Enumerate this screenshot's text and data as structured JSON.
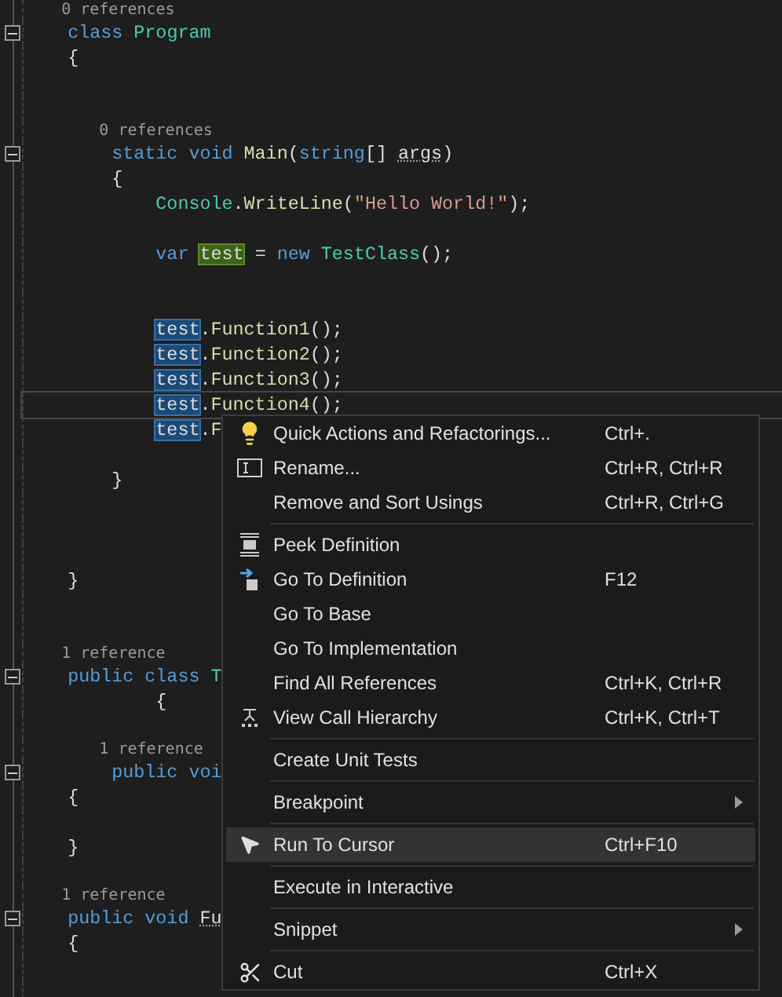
{
  "editor": {
    "lines": [
      {
        "kind": "lens",
        "text": "    0 references"
      },
      {
        "kind": "code",
        "collapsible": true,
        "tokens": [
          {
            "kind": "keyword",
            "text": "    class "
          },
          {
            "kind": "type",
            "text": "Program"
          }
        ]
      },
      {
        "kind": "code",
        "tokens": [
          {
            "kind": "plain",
            "text": "    {"
          }
        ]
      },
      {
        "kind": "blank"
      },
      {
        "kind": "blank"
      },
      {
        "kind": "lens",
        "text": "        0 references"
      },
      {
        "kind": "code",
        "collapsible": true,
        "tokens": [
          {
            "kind": "keyword",
            "text": "        static void "
          },
          {
            "kind": "method",
            "text": "Main"
          },
          {
            "kind": "plain",
            "text": "("
          },
          {
            "kind": "keyword",
            "text": "string"
          },
          {
            "kind": "plain",
            "text": "[] "
          },
          {
            "kind": "unused",
            "text": "args"
          },
          {
            "kind": "plain",
            "text": ")"
          }
        ]
      },
      {
        "kind": "code",
        "tokens": [
          {
            "kind": "plain",
            "text": "        {"
          }
        ]
      },
      {
        "kind": "code",
        "tokens": [
          {
            "kind": "type",
            "text": "            Console"
          },
          {
            "kind": "plain",
            "text": "."
          },
          {
            "kind": "method",
            "text": "WriteLine"
          },
          {
            "kind": "plain",
            "text": "("
          },
          {
            "kind": "string",
            "text": "\"Hello World!\""
          },
          {
            "kind": "plain",
            "text": ");"
          }
        ]
      },
      {
        "kind": "blank"
      },
      {
        "kind": "code",
        "tokens": [
          {
            "kind": "keyword",
            "text": "            var "
          },
          {
            "kind": "write-ref",
            "text": "test"
          },
          {
            "kind": "plain",
            "text": " = "
          },
          {
            "kind": "keyword",
            "text": "new "
          },
          {
            "kind": "type",
            "text": "TestClass"
          },
          {
            "kind": "plain",
            "text": "();"
          }
        ]
      },
      {
        "kind": "blank"
      },
      {
        "kind": "blank"
      },
      {
        "kind": "code",
        "tokens": [
          {
            "kind": "read-ref",
            "text": "            test"
          },
          {
            "kind": "plain",
            "text": "."
          },
          {
            "kind": "method",
            "text": "Function1"
          },
          {
            "kind": "plain",
            "text": "();"
          }
        ]
      },
      {
        "kind": "code",
        "tokens": [
          {
            "kind": "read-ref",
            "text": "            test"
          },
          {
            "kind": "plain",
            "text": "."
          },
          {
            "kind": "method",
            "text": "Function2"
          },
          {
            "kind": "plain",
            "text": "();"
          }
        ]
      },
      {
        "kind": "code",
        "tokens": [
          {
            "kind": "read-ref",
            "text": "            test"
          },
          {
            "kind": "plain",
            "text": "."
          },
          {
            "kind": "method",
            "text": "Function3"
          },
          {
            "kind": "plain",
            "text": "();"
          }
        ]
      },
      {
        "kind": "code",
        "current": true,
        "tokens": [
          {
            "kind": "read-ref",
            "text": "            test"
          },
          {
            "kind": "plain",
            "text": "."
          },
          {
            "kind": "method",
            "text": "Function4"
          },
          {
            "kind": "plain",
            "text": "();"
          }
        ]
      },
      {
        "kind": "code",
        "tokens": [
          {
            "kind": "read-ref",
            "text": "            test"
          },
          {
            "kind": "plain",
            "text": "."
          },
          {
            "kind": "method",
            "text": "F"
          }
        ]
      },
      {
        "kind": "blank"
      },
      {
        "kind": "code",
        "tokens": [
          {
            "kind": "plain",
            "text": "        }"
          }
        ]
      },
      {
        "kind": "blank"
      },
      {
        "kind": "blank"
      },
      {
        "kind": "blank"
      },
      {
        "kind": "code",
        "tokens": [
          {
            "kind": "plain",
            "text": "    }"
          }
        ]
      },
      {
        "kind": "blank"
      },
      {
        "kind": "blank"
      },
      {
        "kind": "lens",
        "text": "    1 reference"
      },
      {
        "kind": "code",
        "collapsible": true,
        "tokens": [
          {
            "kind": "keyword",
            "text": "    public class "
          },
          {
            "kind": "type",
            "text": "T"
          }
        ]
      },
      {
        "kind": "code",
        "tokens": [
          {
            "kind": "plain",
            "text": "            {"
          }
        ]
      },
      {
        "kind": "blank"
      },
      {
        "kind": "lens",
        "text": "        1 reference"
      },
      {
        "kind": "code",
        "collapsible": true,
        "tokens": [
          {
            "kind": "keyword",
            "text": "        public voi"
          }
        ]
      },
      {
        "kind": "code",
        "tokens": [
          {
            "kind": "plain",
            "text": "    {"
          }
        ]
      },
      {
        "kind": "blank"
      },
      {
        "kind": "code",
        "tokens": [
          {
            "kind": "plain",
            "text": "    }"
          }
        ]
      },
      {
        "kind": "blank"
      },
      {
        "kind": "lens",
        "text": "    1 reference"
      },
      {
        "kind": "code",
        "collapsible": true,
        "tokens": [
          {
            "kind": "keyword",
            "text": "    public void "
          },
          {
            "kind": "unused",
            "text": "Fu"
          }
        ]
      },
      {
        "kind": "code",
        "tokens": [
          {
            "kind": "plain",
            "text": "    {"
          }
        ]
      },
      {
        "kind": "blank"
      },
      {
        "kind": "blank"
      }
    ]
  },
  "context_menu": {
    "items": [
      {
        "kind": "item",
        "label": "Quick Actions and Refactorings...",
        "shortcut": "Ctrl+.",
        "submenu": false,
        "selected": false
      },
      {
        "kind": "item",
        "label": "Rename...",
        "shortcut": "Ctrl+R, Ctrl+R",
        "submenu": false,
        "selected": false
      },
      {
        "kind": "item",
        "label": "Remove and Sort Usings",
        "shortcut": "Ctrl+R, Ctrl+G",
        "submenu": false,
        "selected": false
      },
      {
        "kind": "separator"
      },
      {
        "kind": "item",
        "label": "Peek Definition",
        "submenu": false,
        "selected": false
      },
      {
        "kind": "item",
        "label": "Go To Definition",
        "shortcut": "F12",
        "submenu": false,
        "selected": false
      },
      {
        "kind": "item",
        "label": "Go To Base",
        "submenu": false,
        "selected": false
      },
      {
        "kind": "item",
        "label": "Go To Implementation",
        "submenu": false,
        "selected": false
      },
      {
        "kind": "item",
        "label": "Find All References",
        "shortcut": "Ctrl+K, Ctrl+R",
        "submenu": false,
        "selected": false
      },
      {
        "kind": "item",
        "label": "View Call Hierarchy",
        "shortcut": "Ctrl+K, Ctrl+T",
        "submenu": false,
        "selected": false
      },
      {
        "kind": "separator"
      },
      {
        "kind": "item",
        "label": "Create Unit Tests",
        "submenu": false,
        "selected": false
      },
      {
        "kind": "separator"
      },
      {
        "kind": "item",
        "label": "Breakpoint",
        "submenu": true,
        "selected": false
      },
      {
        "kind": "separator"
      },
      {
        "kind": "item",
        "label": "Run To Cursor",
        "shortcut": "Ctrl+F10",
        "submenu": false,
        "selected": true
      },
      {
        "kind": "separator"
      },
      {
        "kind": "item",
        "label": "Execute in Interactive",
        "submenu": false,
        "selected": false
      },
      {
        "kind": "separator"
      },
      {
        "kind": "item",
        "label": "Snippet",
        "submenu": true,
        "selected": false
      },
      {
        "kind": "separator"
      },
      {
        "kind": "item",
        "label": "Cut",
        "shortcut": "Ctrl+X",
        "submenu": false,
        "selected": false
      }
    ]
  }
}
